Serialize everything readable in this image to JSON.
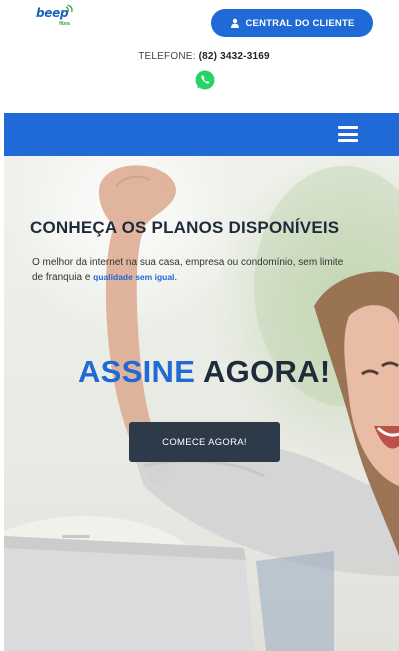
{
  "header": {
    "logo_text": "beep",
    "logo_sub": "fibra",
    "client_button_label": "CENTRAL DO CLIENTE",
    "phone_label": "TELEFONE:",
    "phone_number": "(82) 3432-3169"
  },
  "hero": {
    "title": "CONHEÇA OS PLANOS DISPONÍVEIS",
    "text_part1": "O melhor da internet na sua casa, empresa ou condomínio, sem limite de franquia e",
    "text_highlight": "qualidade sem igual",
    "text_end": ".",
    "cta_word1": "ASSINE",
    "cta_word2": "AGORA!",
    "start_button_label": "COMECE AGORA!"
  },
  "colors": {
    "brand_blue": "#1f6ad6",
    "dark_button": "#2c3a4a",
    "whatsapp_green": "#25d366"
  },
  "icons": [
    "user-icon",
    "whatsapp-icon",
    "hamburger-menu-icon"
  ]
}
